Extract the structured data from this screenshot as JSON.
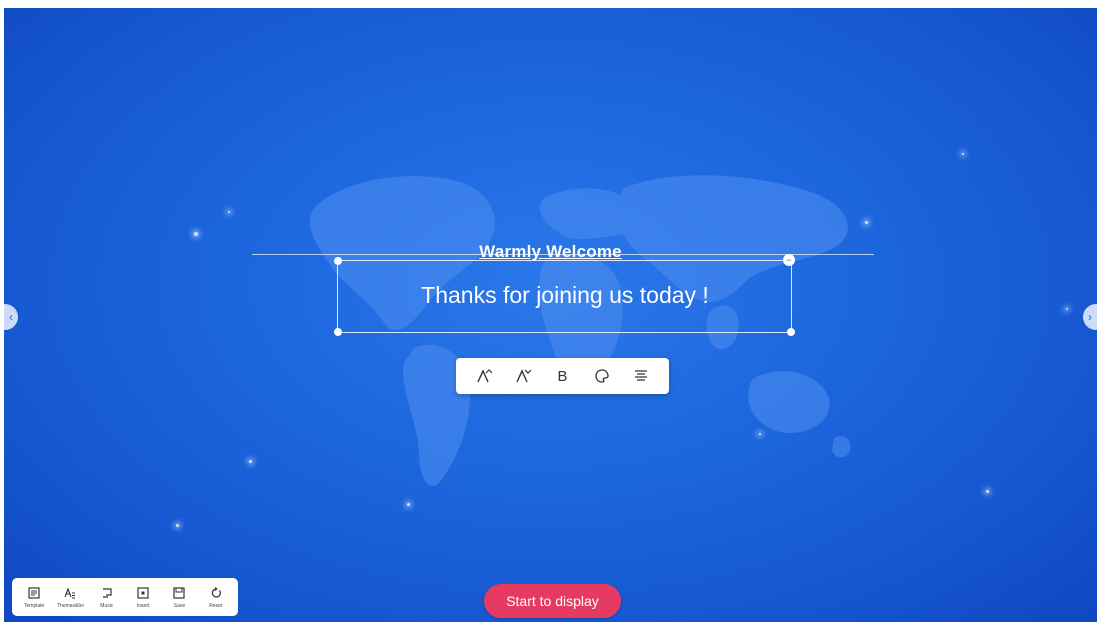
{
  "banner": {
    "title": "Warmly  Welcome",
    "message": "Thanks for joining us today !"
  },
  "format_toolbar": {
    "items": [
      {
        "icon": "font-size-increase-icon"
      },
      {
        "icon": "font-size-decrease-icon"
      },
      {
        "icon": "bold-icon",
        "label": "B"
      },
      {
        "icon": "color-palette-icon"
      },
      {
        "icon": "align-icon"
      }
    ]
  },
  "bottom_toolbar": {
    "items": [
      {
        "label": "Template",
        "icon": "template-icon"
      },
      {
        "label": "Themes&bo",
        "icon": "themes-icon"
      },
      {
        "label": "Music",
        "icon": "music-icon"
      },
      {
        "label": "Insert",
        "icon": "insert-icon"
      },
      {
        "label": "Save",
        "icon": "save-icon"
      },
      {
        "label": "Reset",
        "icon": "reset-icon"
      }
    ]
  },
  "start_button": {
    "label": "Start to display"
  },
  "colors": {
    "background": "#1d66de",
    "start_button": "#e63a63",
    "toolbar": "#ffffff"
  }
}
